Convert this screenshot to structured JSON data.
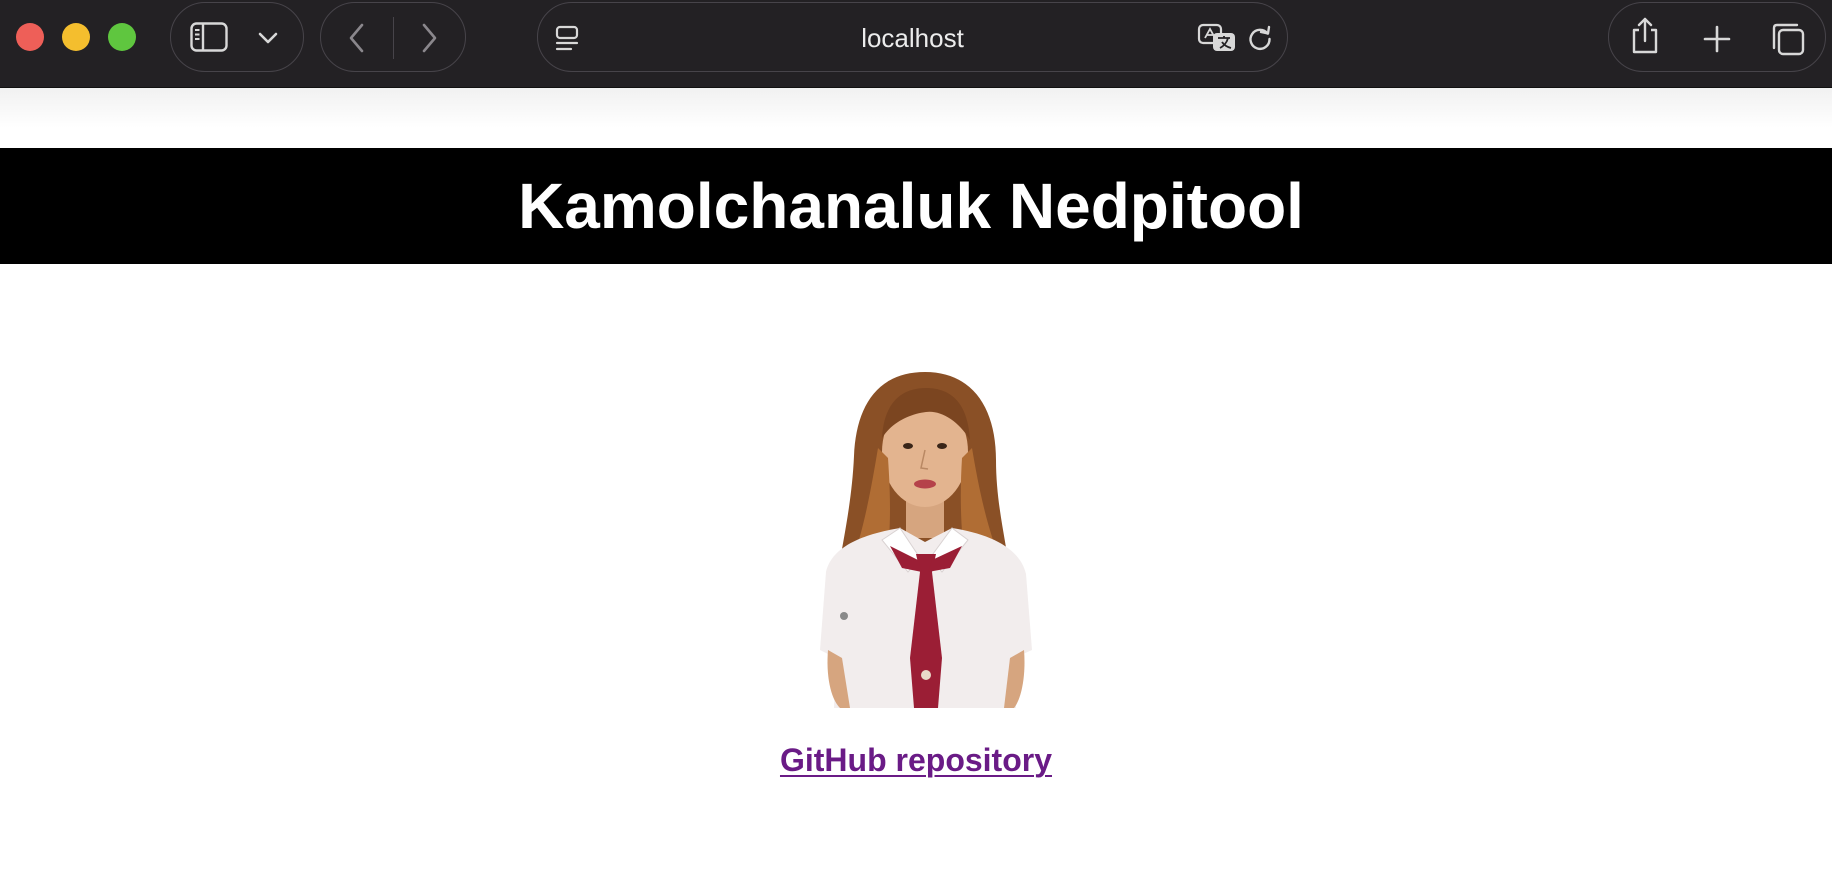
{
  "browser": {
    "address": "localhost",
    "icons": {
      "close": "close-window-button",
      "minimize": "minimize-window-button",
      "zoom": "zoom-window-button",
      "sidebar": "sidebar-icon",
      "sidebar_menu": "chevron-down-icon",
      "back": "back-chevron-icon",
      "forward": "forward-chevron-icon",
      "page_menu": "page-menu-icon",
      "translate": "translate-icon",
      "reload": "reload-icon",
      "share": "share-icon",
      "new_tab": "plus-icon",
      "tabs_overview": "tab-overview-icon"
    },
    "colors": {
      "chrome_bg": "#232124",
      "traffic_red": "#ee5f58",
      "traffic_yellow": "#f4be2e",
      "traffic_green": "#5fc63f"
    }
  },
  "page": {
    "title": "Kamolchanaluk Nedpitool",
    "repo_link_text": "GitHub repository",
    "colors": {
      "header_bg": "#000000",
      "title_color": "#ffffff",
      "link_color": "#6a1b86"
    }
  }
}
